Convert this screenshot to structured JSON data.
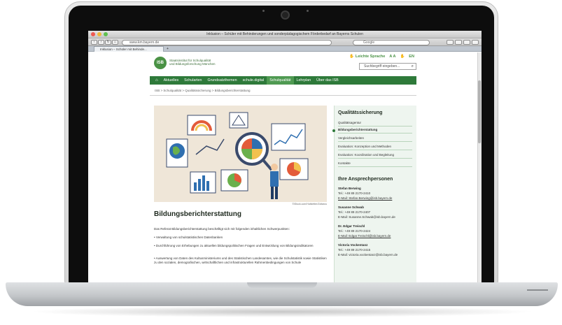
{
  "browser": {
    "window_title": "Inklusion – Schüler mit Behinderungen und sonderpädagogischem Förderbedarf an Bayerns Schulen",
    "url": "www.km.bayern.de",
    "search_placeholder": "Google",
    "tab_label": "Inklusion – Schüler mit Behinde...",
    "new_tab": "+"
  },
  "site": {
    "logo_text": "ISB",
    "institute_line1": "Staatsinstitut für Schulqualität",
    "institute_line2": "und Bildungsforschung München",
    "utility": {
      "easy_language": "Leichte Sprache",
      "font_size": "A A",
      "language": "EN"
    },
    "search_placeholder": "Suchbegriff eingeben..."
  },
  "nav": {
    "items": [
      "Aktuelles",
      "Schularten",
      "Grundsatzthemen",
      "schule.digital",
      "Schulqualität",
      "Lehrplan",
      "Über das ISB"
    ],
    "active_index": 4
  },
  "breadcrumb": "ISB  >  Schulqualität  >  Qualitätssicherung  >  Bildungsberichterstattung",
  "hero": {
    "credit": "©iStock.com/Hufstetter/Zoltarus"
  },
  "main": {
    "title": "Bildungsberichterstattung",
    "intro": "Das Referat Bildungsberichterstattung beschäftigt sich mit folgenden inhaltlichen Schwerpunkten:",
    "bullets": [
      "• Verwaltung von schulstatistischen Datenbanken",
      "• Durchführung von Erhebungen zu aktuellen bildungspolitischen Fragen und Entwicklung von Bildungsindikatoren",
      "• Auswertung von Daten des Kultusministeriums und des Statistischen Landesamtes, wie die Schulstatistik sowie Statistiken zu den sozialen, demografischen, wirtschaftlichen und infrastrukturellen Rahmenbedingungen von Schule"
    ]
  },
  "sidebar": {
    "title": "Qualitätssicherung",
    "items": [
      "Qualitätsagentur",
      "Bildungsberichterstattung",
      "Vergleichsarbeiten",
      "Evaluation: Konzeption und Methoden",
      "Evaluation: Koordination und Begleitung",
      "Kontakte"
    ],
    "active_index": 1,
    "contacts_title": "Ihre Ansprechpersonen",
    "contacts": [
      {
        "name": "Stefan Berwing",
        "tel": "Tel.: +49 89 2170-2410",
        "mail": "E-Mail: Stefan.Berwing@isb.bayern.de"
      },
      {
        "name": "Susanne Schwab",
        "tel": "Tel.: +49 89 2170-2407",
        "mail": "E-Mail: Susanne.Schwab@isb.bayern.de"
      },
      {
        "name": "Dr. Edgar Treischl",
        "tel": "Tel.: +49 89 2170-2424",
        "mail": "E-Mail: Edgar.Treischl@isb.bayern.de"
      },
      {
        "name": "Victoria Vockentanz",
        "tel": "Tel.: +49 89 2170-2415",
        "mail": "E-Mail: victoria.vockentanz@isb.bayern.de"
      }
    ]
  },
  "colors": {
    "brand_green": "#2e7a3a",
    "active_tab_green": "#4f9a52",
    "sidebar_bg": "#eef5ef"
  }
}
